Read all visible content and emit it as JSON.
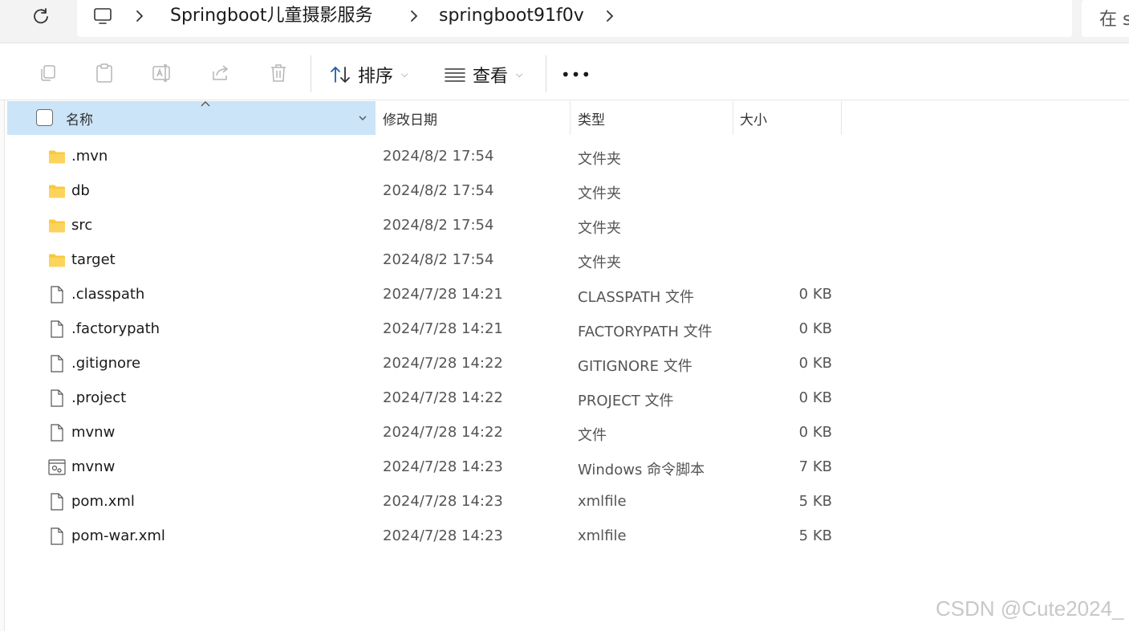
{
  "address_bar": {
    "breadcrumbs": [
      "Springboot儿童摄影服务",
      "springboot91f0v"
    ],
    "search_placeholder": "在 s"
  },
  "command_bar": {
    "sort_label": "排序",
    "view_label": "查看",
    "more_label": "•••"
  },
  "columns": {
    "name": "名称",
    "modified": "修改日期",
    "type": "类型",
    "size": "大小"
  },
  "files": [
    {
      "name": ".mvn",
      "modified": "2024/8/2 17:54",
      "type": "文件夹",
      "size": "",
      "icon": "folder-icon"
    },
    {
      "name": "db",
      "modified": "2024/8/2 17:54",
      "type": "文件夹",
      "size": "",
      "icon": "folder-icon"
    },
    {
      "name": "src",
      "modified": "2024/8/2 17:54",
      "type": "文件夹",
      "size": "",
      "icon": "folder-icon"
    },
    {
      "name": "target",
      "modified": "2024/8/2 17:54",
      "type": "文件夹",
      "size": "",
      "icon": "folder-icon"
    },
    {
      "name": ".classpath",
      "modified": "2024/7/28 14:21",
      "type": "CLASSPATH 文件",
      "size": "0 KB",
      "icon": "file-icon"
    },
    {
      "name": ".factorypath",
      "modified": "2024/7/28 14:21",
      "type": "FACTORYPATH 文件",
      "size": "0 KB",
      "icon": "file-icon"
    },
    {
      "name": ".gitignore",
      "modified": "2024/7/28 14:22",
      "type": "GITIGNORE 文件",
      "size": "0 KB",
      "icon": "file-icon"
    },
    {
      "name": ".project",
      "modified": "2024/7/28 14:22",
      "type": "PROJECT 文件",
      "size": "0 KB",
      "icon": "file-icon"
    },
    {
      "name": "mvnw",
      "modified": "2024/7/28 14:22",
      "type": "文件",
      "size": "0 KB",
      "icon": "file-icon"
    },
    {
      "name": "mvnw",
      "modified": "2024/7/28 14:23",
      "type": "Windows 命令脚本",
      "size": "7 KB",
      "icon": "script-file-icon"
    },
    {
      "name": "pom.xml",
      "modified": "2024/7/28 14:23",
      "type": "xmlfile",
      "size": "5 KB",
      "icon": "file-icon"
    },
    {
      "name": "pom-war.xml",
      "modified": "2024/7/28 14:23",
      "type": "xmlfile",
      "size": "5 KB",
      "icon": "file-icon"
    }
  ],
  "watermark": "CSDN @Cute2024_",
  "colors": {
    "selected_header": "#cce4f7",
    "folder": "#f8c93e",
    "titlebar": "#f3f3f3"
  }
}
